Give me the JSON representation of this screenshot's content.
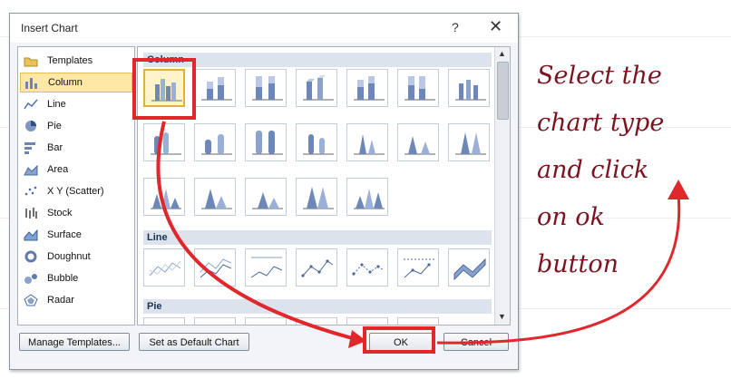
{
  "dialog": {
    "title": "Insert Chart",
    "help_glyph": "?",
    "close_glyph": "✕"
  },
  "categories": [
    {
      "label": "Templates",
      "icon": "folder-icon",
      "selected": false
    },
    {
      "label": "Column",
      "icon": "column-chart-icon",
      "selected": true
    },
    {
      "label": "Line",
      "icon": "line-chart-icon",
      "selected": false
    },
    {
      "label": "Pie",
      "icon": "pie-chart-icon",
      "selected": false
    },
    {
      "label": "Bar",
      "icon": "bar-chart-icon",
      "selected": false
    },
    {
      "label": "Area",
      "icon": "area-chart-icon",
      "selected": false
    },
    {
      "label": "X Y (Scatter)",
      "icon": "scatter-chart-icon",
      "selected": false
    },
    {
      "label": "Stock",
      "icon": "stock-chart-icon",
      "selected": false
    },
    {
      "label": "Surface",
      "icon": "surface-chart-icon",
      "selected": false
    },
    {
      "label": "Doughnut",
      "icon": "doughnut-chart-icon",
      "selected": false
    },
    {
      "label": "Bubble",
      "icon": "bubble-chart-icon",
      "selected": false
    },
    {
      "label": "Radar",
      "icon": "radar-chart-icon",
      "selected": false
    }
  ],
  "gallery": {
    "sections": [
      "Column",
      "Line",
      "Pie"
    ]
  },
  "buttons": {
    "manage_templates": "Manage Templates...",
    "set_default": "Set as Default Chart",
    "ok": "OK",
    "cancel": "Cancel"
  },
  "annotation": {
    "text": "Select the\nchart type\nand click\non ok\nbutton",
    "color": "#7b1420",
    "arrow_color": "#e0272c"
  }
}
